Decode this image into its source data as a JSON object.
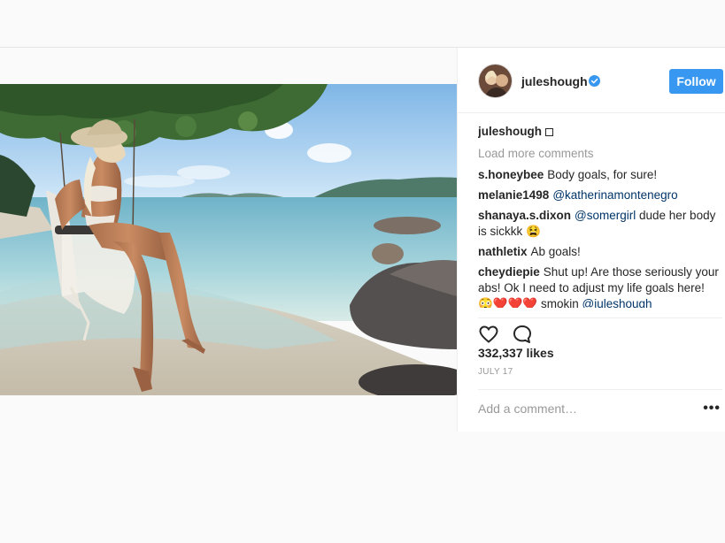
{
  "post": {
    "username": "juleshough",
    "follow_label": "Follow",
    "caption_user": "juleshough",
    "load_more": "Load more comments",
    "comments": [
      {
        "user": "s.honeybee",
        "text": "Body goals, for sure!"
      },
      {
        "user": "melanie1498",
        "mention": "@katherinamontenegro"
      },
      {
        "user": "shanaya.s.dixon",
        "mention": "@somergirl",
        "text": " dude her body is sickkk 😫"
      },
      {
        "user": "nathletix",
        "text": "Ab goals!"
      },
      {
        "user": "cheydiepie",
        "text": "Shut up! Are those seriously your abs! Ok I need to adjust my life goals here! 😳❤️❤️❤️ smokin ",
        "mention": "@juleshough"
      }
    ],
    "likes": "332,337 likes",
    "date": "JULY 17",
    "add_comment_placeholder": "Add a comment…",
    "more_label": "•••"
  },
  "icons": {
    "like": "heart-icon",
    "comment": "comment-icon",
    "verified": "verified-badge-icon",
    "more": "more-options-icon"
  },
  "colors": {
    "follow_button": "#3897f0",
    "mention": "#003569",
    "muted": "#999999"
  }
}
